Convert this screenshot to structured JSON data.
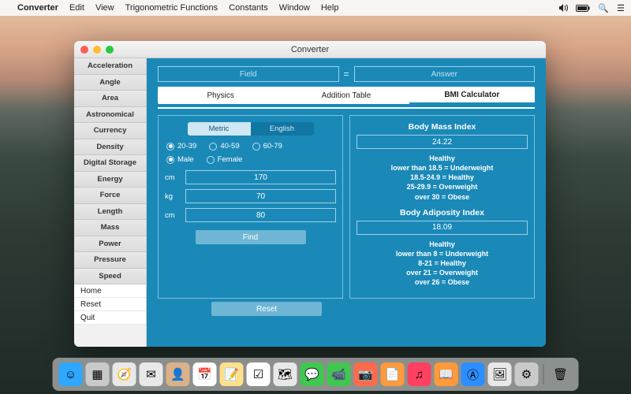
{
  "menubar": {
    "app": "Converter",
    "items": [
      "Edit",
      "View",
      "Trigonometric Functions",
      "Constants",
      "Window",
      "Help"
    ]
  },
  "window": {
    "title": "Converter"
  },
  "sidebar": {
    "categories": [
      "Acceleration",
      "Angle",
      "Area",
      "Astronomical",
      "Currency",
      "Density",
      "Digital Storage",
      "Energy",
      "Force",
      "Length",
      "Mass",
      "Power",
      "Pressure",
      "Speed"
    ],
    "actions": [
      "Home",
      "Reset",
      "Quit"
    ]
  },
  "toprow": {
    "field_placeholder": "Field",
    "eq": "=",
    "answer_placeholder": "Answer"
  },
  "tabs": [
    "Physics",
    "Addition Table",
    "BMI Calculator"
  ],
  "active_tab": 2,
  "left": {
    "seg_metric": "Metric",
    "seg_english": "English",
    "seg_active": "metric",
    "age_options": [
      "20-39",
      "40-59",
      "60-79"
    ],
    "age_selected": 0,
    "sex_options": [
      "Male",
      "Female"
    ],
    "sex_selected": 0,
    "rows": [
      {
        "label": "cm",
        "value": "170"
      },
      {
        "label": "kg",
        "value": "70"
      },
      {
        "label": "cm",
        "value": "80"
      }
    ],
    "find_label": "Find",
    "reset_label": "Reset"
  },
  "right": {
    "bmi_title": "Body Mass Index",
    "bmi_value": "24.22",
    "bmi_desc": [
      "Healthy",
      "lower than 18.5 = Underweight",
      "18.5-24.9 = Healthy",
      "25-29.9 = Overweight",
      "over 30 = Obese"
    ],
    "bai_title": "Body Adiposity Index",
    "bai_value": "18.09",
    "bai_desc": [
      "Healthy",
      "lower than 8 = Underweight",
      "8-21 = Healthy",
      "over 21 = Overweight",
      "over 26 = Obese"
    ]
  },
  "dock": {
    "items": [
      {
        "name": "finder",
        "bg": "#2ea7ff",
        "glyph": "☺"
      },
      {
        "name": "launchpad",
        "bg": "#c9c9c9",
        "glyph": "▦"
      },
      {
        "name": "safari",
        "bg": "#e8e8e8",
        "glyph": "🧭"
      },
      {
        "name": "mail",
        "bg": "#e8e8e8",
        "glyph": "✉"
      },
      {
        "name": "contacts",
        "bg": "#d9b28a",
        "glyph": "👤"
      },
      {
        "name": "calendar",
        "bg": "#fff",
        "glyph": "📅"
      },
      {
        "name": "notes",
        "bg": "#ffe08a",
        "glyph": "📝"
      },
      {
        "name": "reminders",
        "bg": "#fff",
        "glyph": "☑"
      },
      {
        "name": "maps",
        "bg": "#e8e8e8",
        "glyph": "🗺"
      },
      {
        "name": "messages",
        "bg": "#3fc750",
        "glyph": "💬"
      },
      {
        "name": "facetime",
        "bg": "#3fc750",
        "glyph": "📹"
      },
      {
        "name": "photobooth",
        "bg": "#ff6b4a",
        "glyph": "📷"
      },
      {
        "name": "pages",
        "bg": "#ff9a3c",
        "glyph": "📄"
      },
      {
        "name": "itunes",
        "bg": "#ff4060",
        "glyph": "♫"
      },
      {
        "name": "ibooks",
        "bg": "#ff9a3c",
        "glyph": "📖"
      },
      {
        "name": "appstore",
        "bg": "#2d8fff",
        "glyph": "Ⓐ"
      },
      {
        "name": "preview",
        "bg": "#e8e8e8",
        "glyph": "🖼"
      },
      {
        "name": "settings",
        "bg": "#c9c9c9",
        "glyph": "⚙"
      }
    ],
    "trash": {
      "name": "trash",
      "bg": "transparent",
      "glyph": "🗑"
    }
  }
}
